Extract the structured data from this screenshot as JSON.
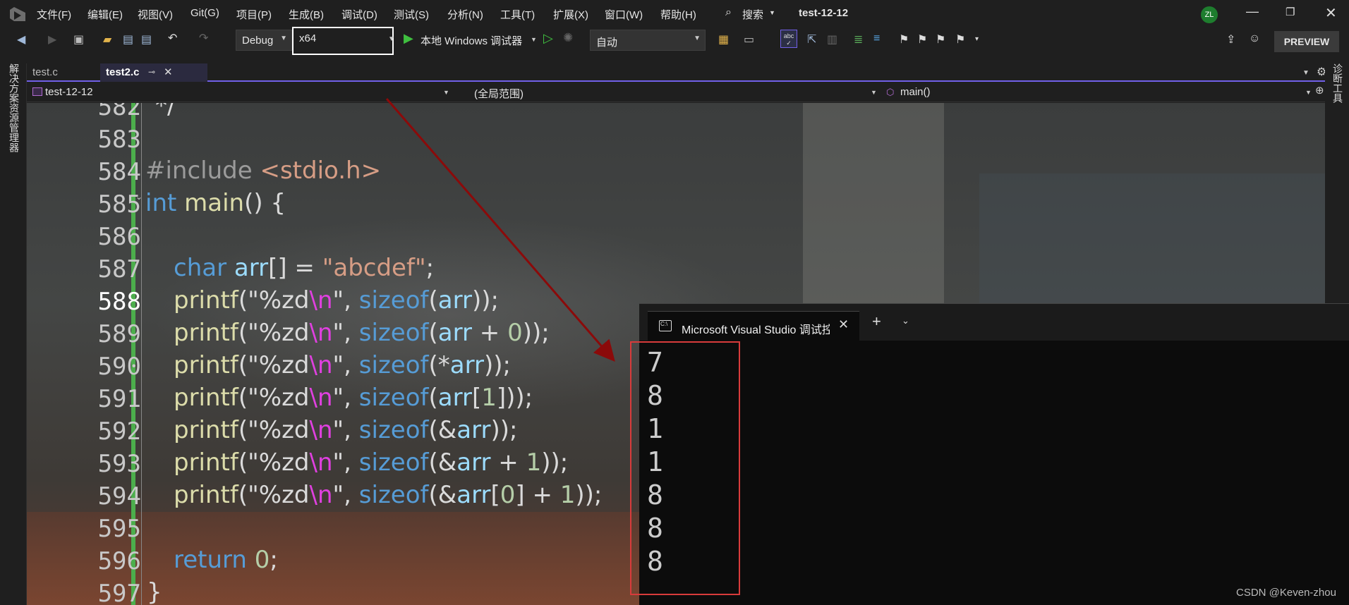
{
  "menu": [
    "文件(F)",
    "编辑(E)",
    "视图(V)",
    "Git(G)",
    "项目(P)",
    "生成(B)",
    "调试(D)",
    "测试(S)",
    "分析(N)",
    "工具(T)",
    "扩展(X)",
    "窗口(W)",
    "帮助(H)"
  ],
  "search_label": "搜索",
  "solution_title": "test-12-12",
  "user_initials": "ZL",
  "toolbar": {
    "config": "Debug",
    "platform": "x64",
    "run_label": "本地 Windows 调试器",
    "auto_label": "自动",
    "preview_label": "PREVIEW"
  },
  "tabs": [
    {
      "label": "test.c",
      "active": false
    },
    {
      "label": "test2.c",
      "active": true
    }
  ],
  "navbar": {
    "project": "test-12-12",
    "scope": "(全局范围)",
    "function": "main()"
  },
  "left_panel": "解决方案资源管理器",
  "right_panel": "诊断工具",
  "code_lines": [
    {
      "n": "582",
      "text": "*/"
    },
    {
      "n": "583",
      "text": ""
    },
    {
      "n": "584",
      "text": "#include <stdio.h>"
    },
    {
      "n": "585",
      "text": "int main() {"
    },
    {
      "n": "586",
      "text": ""
    },
    {
      "n": "587",
      "text": "char arr[] = \"abcdef\";"
    },
    {
      "n": "588",
      "text": "printf(\"%zd\\n\", sizeof(arr));"
    },
    {
      "n": "589",
      "text": "printf(\"%zd\\n\", sizeof(arr + 0));"
    },
    {
      "n": "590",
      "text": "printf(\"%zd\\n\", sizeof(*arr));"
    },
    {
      "n": "591",
      "text": "printf(\"%zd\\n\", sizeof(arr[1]));"
    },
    {
      "n": "592",
      "text": "printf(\"%zd\\n\", sizeof(&arr));"
    },
    {
      "n": "593",
      "text": "printf(\"%zd\\n\", sizeof(&arr + 1));"
    },
    {
      "n": "594",
      "text": "printf(\"%zd\\n\", sizeof(&arr[0] + 1));"
    },
    {
      "n": "595",
      "text": ""
    },
    {
      "n": "596",
      "text": "return 0;"
    },
    {
      "n": "597",
      "text": "}"
    }
  ],
  "console": {
    "tab_title": "Microsoft Visual Studio 调试控制台",
    "output": [
      "7",
      "8",
      "1",
      "1",
      "8",
      "8",
      "8"
    ]
  },
  "watermark": "CSDN @Keven-zhou",
  "colors": {
    "accent": "#7160e8",
    "keyword": "#569cd6",
    "function": "#dcdcaa",
    "string": "#d69d85",
    "escape": "#e040e0",
    "variable": "#9cdcfe",
    "number": "#b5cea8",
    "highlight_box": "#d83b3b"
  }
}
